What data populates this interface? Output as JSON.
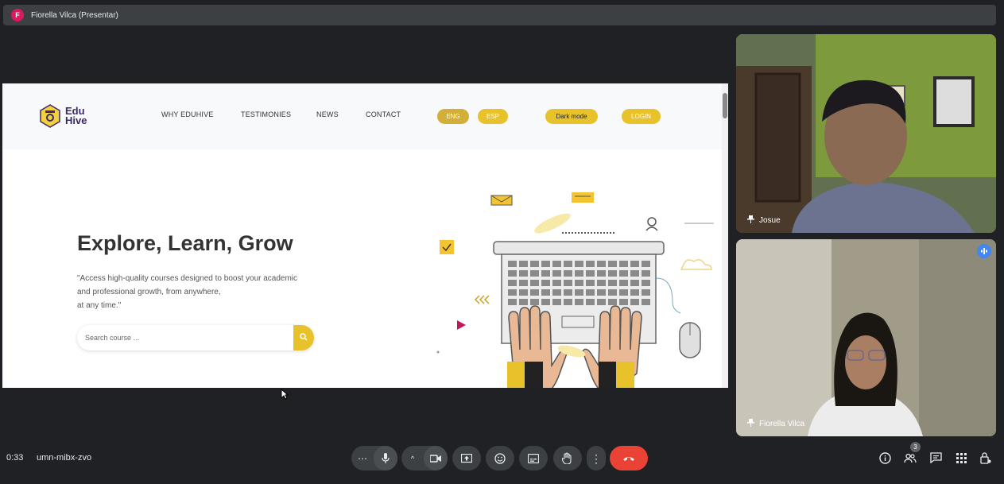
{
  "presenter": {
    "avatar_letter": "F",
    "name": "Fiorella Vilca (Presentar)"
  },
  "website": {
    "logo_line1": "Edu",
    "logo_line2": "Hive",
    "nav": [
      "WHY EDUHIVE",
      "TESTIMONIES",
      "NEWS",
      "CONTACT"
    ],
    "lang_eng": "ENG",
    "lang_esp": "ESP",
    "dark_mode": "Dark mode",
    "login": "LOGIN",
    "hero_title": "Explore, Learn, Grow",
    "hero_text_1": "\"Access high-quality courses designed to boost your academic",
    "hero_text_2": "and professional growth, from anywhere,",
    "hero_text_3": "at any time.\"",
    "search_placeholder": "Search course ...",
    "accent_color": "#e8c22b"
  },
  "participants": [
    {
      "name": "Josue"
    },
    {
      "name": "Fiorella Vilca"
    }
  ],
  "bottom_bar": {
    "time": "0:33",
    "meeting_code": "umn-mibx-zvo",
    "people_count": "3",
    "end_call_color": "#ea4335"
  }
}
